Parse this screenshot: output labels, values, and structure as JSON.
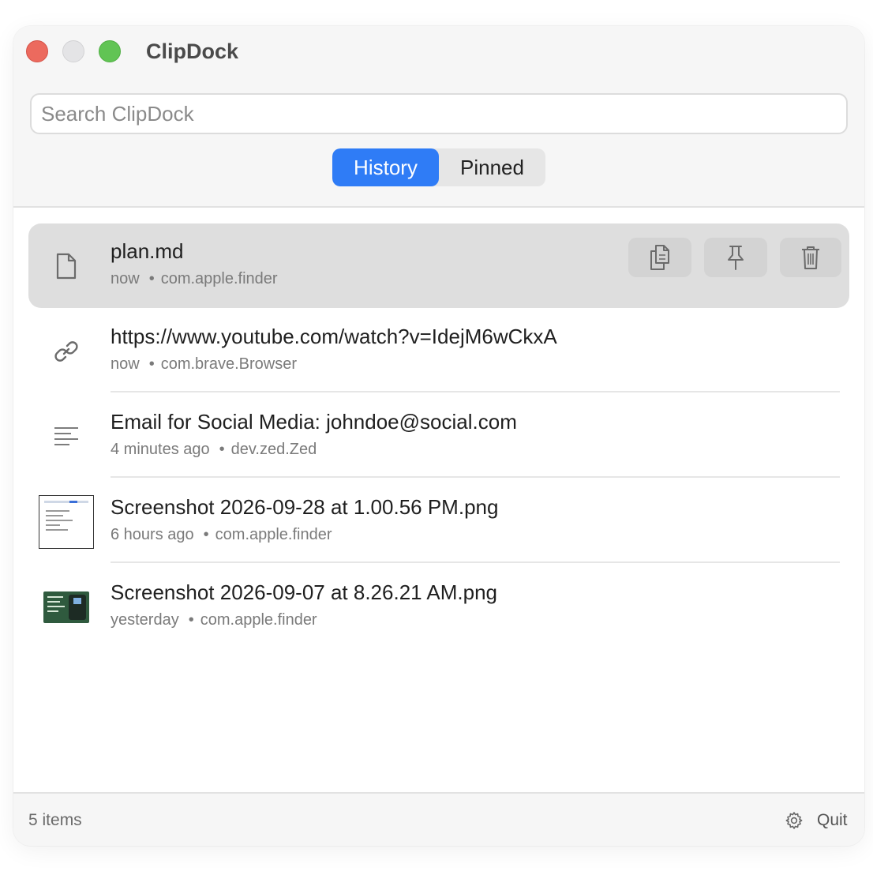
{
  "app": {
    "title": "ClipDock"
  },
  "search": {
    "placeholder": "Search ClipDock",
    "value": ""
  },
  "tabs": [
    {
      "label": "History",
      "active": true
    },
    {
      "label": "Pinned",
      "active": false
    }
  ],
  "items": [
    {
      "primary": "plan.md",
      "time": "now",
      "source": "com.apple.finder",
      "icon": "document-icon",
      "selected": true
    },
    {
      "primary": "https://www.youtube.com/watch?v=IdejM6wCkxA",
      "time": "now",
      "source": "com.brave.Browser",
      "icon": "link-icon"
    },
    {
      "primary": "Email for Social Media: johndoe@social.com",
      "time": "4 minutes ago",
      "source": "dev.zed.Zed",
      "icon": "text-lines-icon"
    },
    {
      "primary": "Screenshot 2026-09-28 at 1.00.56 PM.png",
      "time": "6 hours ago",
      "source": "com.apple.finder",
      "icon": "image-thumbnail"
    },
    {
      "primary": "Screenshot 2026-09-07 at 8.26.21 AM.png",
      "time": "yesterday",
      "source": "com.apple.finder",
      "icon": "image-thumbnail"
    }
  ],
  "row_actions": [
    "copy-icon",
    "pin-icon",
    "trash-icon"
  ],
  "footer": {
    "count": "5 items",
    "quit_label": "Quit"
  },
  "colors": {
    "accent": "#2f7cf6",
    "close": "#ec6a5e",
    "maximize": "#61c454"
  }
}
